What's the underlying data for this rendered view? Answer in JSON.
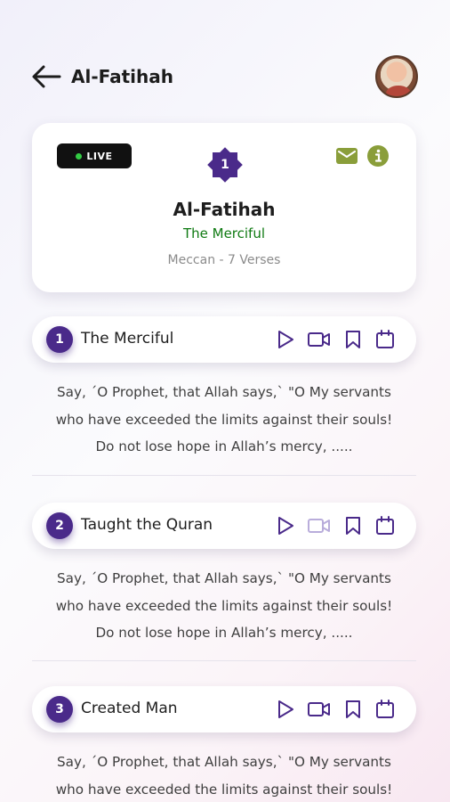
{
  "header": {
    "title": "Al-Fatihah"
  },
  "info_card": {
    "live_label": "LIVE",
    "surah_number": "1",
    "title": "Al-Fatihah",
    "subtitle": "The Merciful",
    "meta": "Meccan - 7 Verses"
  },
  "colors": {
    "primary": "#4a2a8a",
    "accent_green": "#8a9e3a",
    "subtitle_green": "#0f7a12",
    "live_dot": "#33cc44"
  },
  "verses": [
    {
      "number": "1",
      "title": "The Merciful",
      "line1": "Say, ˊO Prophet, that Allah says,ˋ \"O My servants",
      "line2": "who have exceeded the limits against their souls!",
      "line3": "Do not lose hope in Allah’s mercy, ....."
    },
    {
      "number": "2",
      "title": "Taught the Quran",
      "line1": "Say, ˊO Prophet, that Allah says,ˋ \"O My servants",
      "line2": "who have exceeded the limits against their souls!",
      "line3": "Do not lose hope in Allah’s mercy, ....."
    },
    {
      "number": "3",
      "title": "Created Man",
      "line1": "Say, ˊO Prophet, that Allah says,ˋ \"O My servants",
      "line2": "who have exceeded the limits against their souls!"
    }
  ]
}
